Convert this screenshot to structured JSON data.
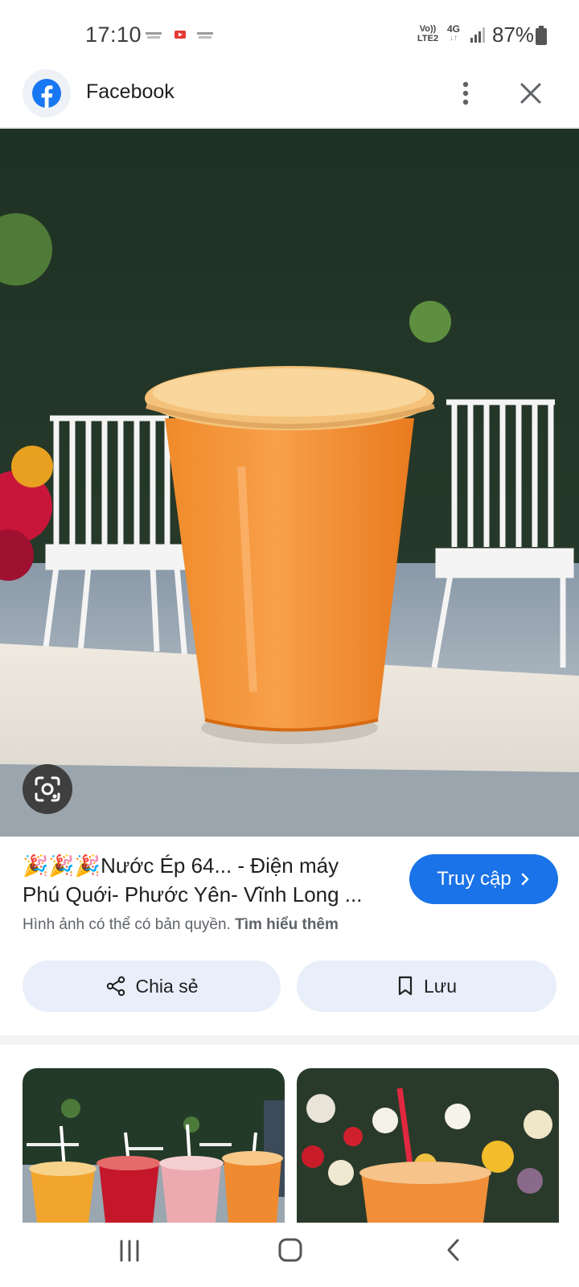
{
  "status_bar": {
    "time": "17:10",
    "network_line1": "Vo))",
    "network_line2": "LTE2",
    "network_type": "4G",
    "battery": "87%"
  },
  "app_bar": {
    "title": "Facebook",
    "icons": [
      "facebook-logo",
      "more-vert-icon",
      "close-icon"
    ]
  },
  "result": {
    "title_line1": "🎉🎉🎉Nước Ép 64... - Điện máy",
    "title_line2": "Phú Quới- Phước Yên- Vĩnh Long ...",
    "visit_label": "Truy cập",
    "copyright_text": "Hình ảnh có thể có bản quyền.",
    "learn_more": "Tìm hiểu thêm"
  },
  "actions": {
    "share_label": "Chia sẻ",
    "save_label": "Lưu"
  },
  "colors": {
    "accent": "#1a73e8",
    "button_bg": "#e8effa",
    "facebook_blue": "#1877f2"
  }
}
